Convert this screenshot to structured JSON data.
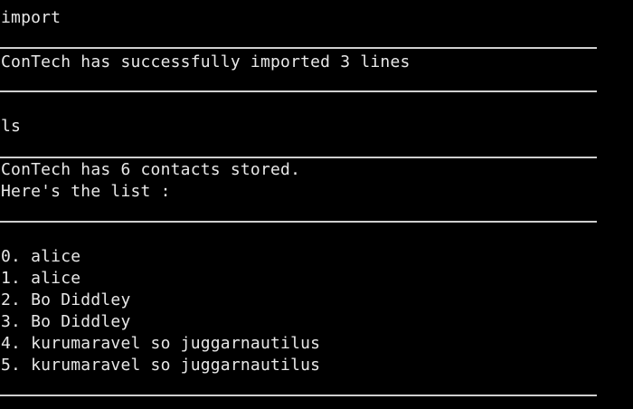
{
  "terminal": {
    "colors": {
      "background": "#000000",
      "text": "#e8e8e8",
      "rule": "#cfcfcf"
    },
    "lines": {
      "cmd_import": "import",
      "import_result": "ConTech has successfully imported 3 lines",
      "cmd_ls": "ls",
      "ls_count": "ConTech has 6 contacts stored.",
      "ls_header": "Here's the list :",
      "contacts": [
        "0. alice",
        "1. alice",
        "2. Bo Diddley",
        "3. Bo Diddley",
        "4. kurumaravel so juggarnautilus",
        "5. kurumaravel so juggarnautilus"
      ]
    }
  }
}
